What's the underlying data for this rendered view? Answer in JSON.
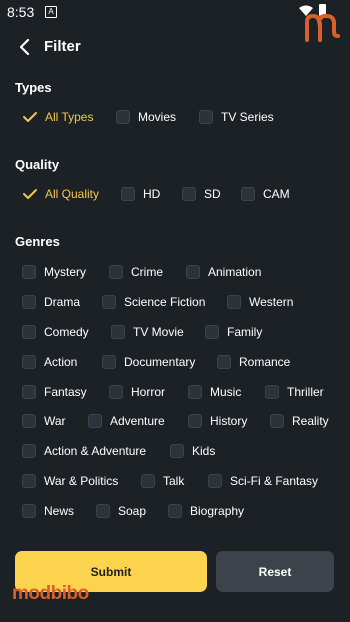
{
  "status_bar": {
    "time": "8:53",
    "indicator": "A"
  },
  "header": {
    "title": "Filter",
    "back_icon": "back-arrow-icon"
  },
  "types": {
    "title": "Types",
    "options": [
      {
        "label": "All Types",
        "selected": true
      },
      {
        "label": "Movies",
        "selected": false
      },
      {
        "label": "TV Series",
        "selected": false
      }
    ]
  },
  "quality": {
    "title": "Quality",
    "options": [
      {
        "label": "All Quality",
        "selected": true
      },
      {
        "label": "HD",
        "selected": false
      },
      {
        "label": "SD",
        "selected": false
      },
      {
        "label": "CAM",
        "selected": false
      }
    ]
  },
  "genres": {
    "title": "Genres",
    "rows": [
      [
        "Mystery",
        "Crime",
        "Animation"
      ],
      [
        "Drama",
        "Science Fiction",
        "Western"
      ],
      [
        "Comedy",
        "TV Movie",
        "Family"
      ],
      [
        "Action",
        "Documentary",
        "Romance"
      ],
      [
        "Fantasy",
        "Horror",
        "Music",
        "Thriller"
      ],
      [
        "War",
        "Adventure",
        "History",
        "Reality"
      ],
      [
        "Action & Adventure",
        "Kids"
      ],
      [
        "War & Politics",
        "Talk",
        "Sci-Fi & Fantasy"
      ],
      [
        "News",
        "Soap",
        "Biography"
      ]
    ]
  },
  "buttons": {
    "submit": "Submit",
    "reset": "Reset"
  },
  "watermark": "modbibo",
  "colors": {
    "background": "#1c2126",
    "accent": "#fcd34d",
    "selected_text": "#f2c94c",
    "checkbox": "#2c333b",
    "reset_button": "#3d434a",
    "logo": "#d9602a"
  }
}
